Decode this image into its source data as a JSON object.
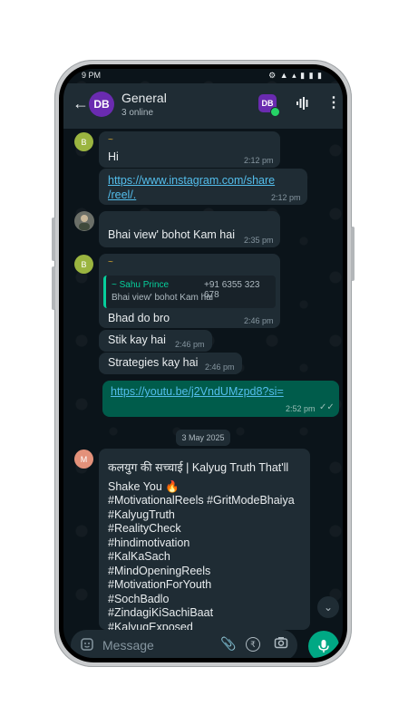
{
  "status": {
    "time": "9 PM",
    "icons": "⚙ ▲ ▴ ▮ ▮ ▮"
  },
  "header": {
    "back": "←",
    "avatar_text": "DB",
    "title": "General",
    "subtitle": "3 online",
    "badge_text": "DB"
  },
  "messages": {
    "m1": {
      "avatar": "B",
      "sender": "~",
      "text": "Hi",
      "time": "2:12 pm"
    },
    "m2": {
      "text": "https://www.instagram.com/share/reel/",
      "line1": "https://www.instagram.com/share",
      "line2": "/reel/.",
      "time": "2:12 pm"
    },
    "m3": {
      "text": "Bhai view' bohot Kam hai",
      "time": "2:35 pm"
    },
    "m4": {
      "avatar": "B",
      "sender": "~",
      "quote_name": "~ Sahu Prince",
      "quote_phone": "+91 6355 323 678",
      "quote_text": "Bhai view' bohot Kam hai",
      "text": "Bhad do bro",
      "time": "2:46 pm"
    },
    "m5": {
      "text": "Stik kay hai",
      "time": "2:46 pm"
    },
    "m6": {
      "text": "Strategies kay hai",
      "time": "2:46 pm"
    },
    "m7": {
      "text": "https://youtu.be/j2VndUMzpd8?si=",
      "time": "2:52 pm",
      "ticks": "✓✓"
    },
    "m8": {
      "avatar": "M",
      "lines": [
        "कलयुग की सच्चाई | Kalyug Truth That'll",
        "Shake You 🔥",
        "#MotivationalReels #GritModeBhaiya",
        "#KalyugTruth",
        "#RealityCheck",
        " #hindimotivation",
        "#KalKaSach",
        "#MindOpeningReels",
        "#MotivationForYouth",
        "#SochBadlo",
        "#ZindagiKiSachiBaat",
        "#KalyugExposed"
      ]
    }
  },
  "date_chip": "3 May 2025",
  "input": {
    "placeholder": "Message"
  },
  "colors": {
    "accent": "#00a884",
    "outgoing": "#005c4b",
    "incoming": "#1f2c34"
  }
}
